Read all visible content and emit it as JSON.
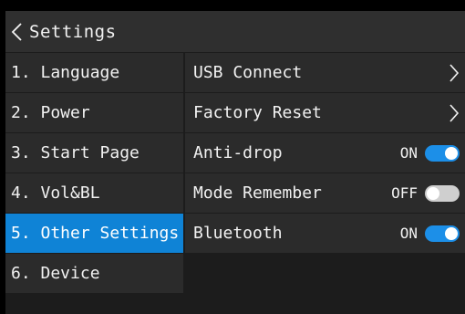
{
  "header": {
    "back_icon": "chevron-left-icon",
    "title": "Settings"
  },
  "sidebar": {
    "items": [
      {
        "label": "1. Language",
        "active": false
      },
      {
        "label": "2. Power",
        "active": false
      },
      {
        "label": "3. Start Page",
        "active": false
      },
      {
        "label": "4. Vol&BL",
        "active": false
      },
      {
        "label": "5. Other Settings",
        "active": true
      },
      {
        "label": "6. Device",
        "active": false
      }
    ]
  },
  "content": {
    "rows": [
      {
        "label": "USB Connect",
        "icon": "chevron-right-icon"
      },
      {
        "label": "Factory Reset",
        "icon": "chevron-right-icon"
      },
      {
        "label": "Anti-drop",
        "status": "ON",
        "toggle": "on"
      },
      {
        "label": "Mode Remember",
        "status": "OFF",
        "toggle": "off"
      },
      {
        "label": "Bluetooth",
        "status": "ON",
        "toggle": "on"
      }
    ]
  },
  "colors": {
    "accent": "#0f83d6",
    "toggle_on": "#1c8fe8",
    "toggle_off": "#cfcfcf",
    "background": "#1c1c1c",
    "row": "#2b2b2b",
    "header": "#2f2f2f"
  }
}
